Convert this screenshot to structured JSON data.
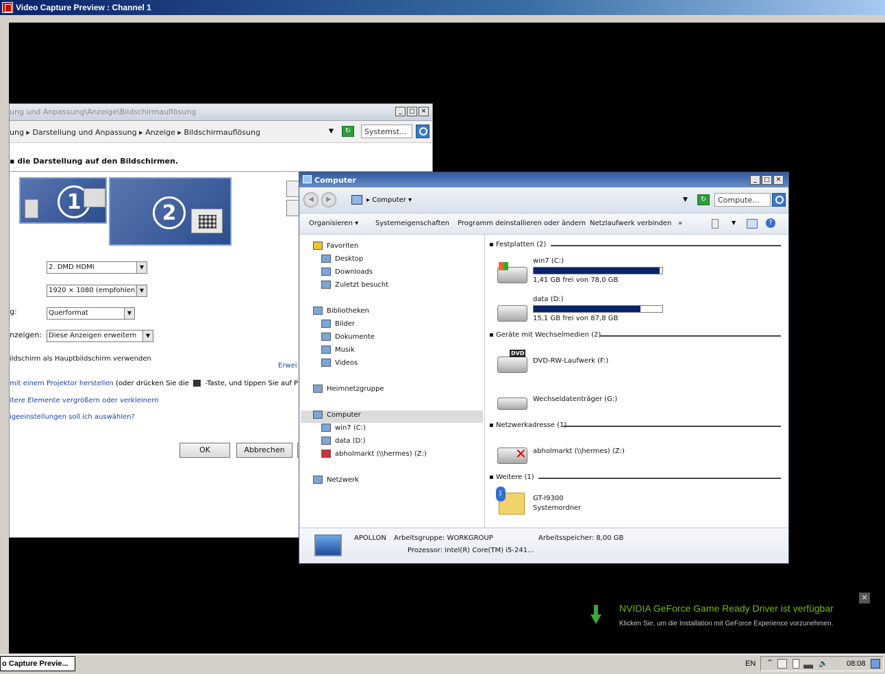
{
  "outer": {
    "title": "Video Capture Preview : Channel 1"
  },
  "display_window": {
    "title": "ung und Anpassung\\Anzeige\\Bildschirmauflösung",
    "breadcrumb": "ung  ▸  Darstellung und Anpassung  ▸  Anzeige  ▸  Bildschirmauflösung",
    "search_placeholder": "Systemst...",
    "heading": "die Darstellung auf den Bildschirmen.",
    "monitor1": "1",
    "monitor2": "2",
    "display_value": "2. DMD HDMI",
    "resolution_value": "1920 × 1080 (empfohlen)",
    "orientation_label": "g:",
    "orientation_value": "Querformat",
    "multi_label": "nzeigen:",
    "multi_value": "Diese Anzeigen erweitern",
    "primary_checkbox_text": "ildschirm als Hauptbildschirm verwenden",
    "advanced_link": "Erwei",
    "projector_link": "mit einem Projektor herstellen",
    "projector_text": "(oder drücken Sie die",
    "projector_text2": "-Taste, und tippen Sie auf P)",
    "elements_link": "itere Elemente vergrößern oder verkleinern",
    "settings_link": "igeeinstellungen soll ich auswählen?",
    "ok": "OK",
    "cancel": "Abbrechen"
  },
  "computer_window": {
    "title": "Computer",
    "address": "Computer",
    "search_placeholder": "Compute...",
    "toolbar": [
      "Organisieren ▾",
      "Systemeigenschaften",
      "Programm deinstallieren oder ändern",
      "Netzlaufwerk verbinden",
      "»"
    ],
    "nav": [
      {
        "label": "Favoriten",
        "indent": 0,
        "icon": "star-icon"
      },
      {
        "label": "Desktop",
        "indent": 1,
        "icon": "desktop-icon"
      },
      {
        "label": "Downloads",
        "indent": 1,
        "icon": "downloads-icon"
      },
      {
        "label": "Zuletzt besucht",
        "indent": 1,
        "icon": "recent-icon"
      },
      {
        "label": "Bibliotheken",
        "indent": 0,
        "icon": "library-icon"
      },
      {
        "label": "Bilder",
        "indent": 1,
        "icon": "pictures-icon"
      },
      {
        "label": "Dokumente",
        "indent": 1,
        "icon": "documents-icon"
      },
      {
        "label": "Musik",
        "indent": 1,
        "icon": "music-icon"
      },
      {
        "label": "Videos",
        "indent": 1,
        "icon": "videos-icon"
      },
      {
        "label": "Heimnetzgruppe",
        "indent": 0,
        "icon": "homegroup-icon"
      },
      {
        "label": "Computer",
        "indent": 0,
        "icon": "computer-icon"
      },
      {
        "label": "win7 (C:)",
        "indent": 1,
        "icon": "drive-icon"
      },
      {
        "label": "data (D:)",
        "indent": 1,
        "icon": "drive-icon"
      },
      {
        "label": "abholmarkt (\\\\hermes) (Z:)",
        "indent": 1,
        "icon": "network-drive-disconnected-icon"
      },
      {
        "label": "Netzwerk",
        "indent": 0,
        "icon": "network-icon"
      }
    ],
    "groups": {
      "hdd": "Festplatten (2)",
      "removable": "Geräte mit Wechselmedien (2)",
      "network": "Netzwerkadresse (1)",
      "other": "Weitere (1)"
    },
    "drives": [
      {
        "name": "win7 (C:)",
        "free": "1,41 GB frei von 78,0 GB",
        "used_fraction": 0.98
      },
      {
        "name": "data (D:)",
        "free": "15,1 GB frei von 87,8 GB",
        "used_fraction": 0.83
      }
    ],
    "dvd": {
      "name": "DVD-RW-Laufwerk (F:)",
      "badge": "DVD"
    },
    "removable": {
      "name": "Wechseldatenträger (G:)"
    },
    "netdrive": {
      "name": "abholmarkt (\\\\hermes) (Z:)"
    },
    "other": {
      "name": "GT-I9300",
      "sub": "Systemordner"
    },
    "details": {
      "name": "APOLLON",
      "workgroup": "Arbeitsgruppe: WORKGROUP",
      "memory": "Arbeitsspeicher: 8,00 GB",
      "cpu": "Prozessor: Intel(R) Core(TM) i5-241..."
    }
  },
  "notification": {
    "title": "NVIDIA GeForce Game Ready Driver ist verfügbar",
    "body": "Klicken Sie, um die Installation mit GeForce Experience vorzunehmen.",
    "close": "✕"
  },
  "taskbar": {
    "button": "o Capture Previe...",
    "lang": "EN",
    "clock": "08:08"
  },
  "colors": {
    "nvidia_green": "#76b900",
    "capacity_bar": "#0a246a"
  }
}
